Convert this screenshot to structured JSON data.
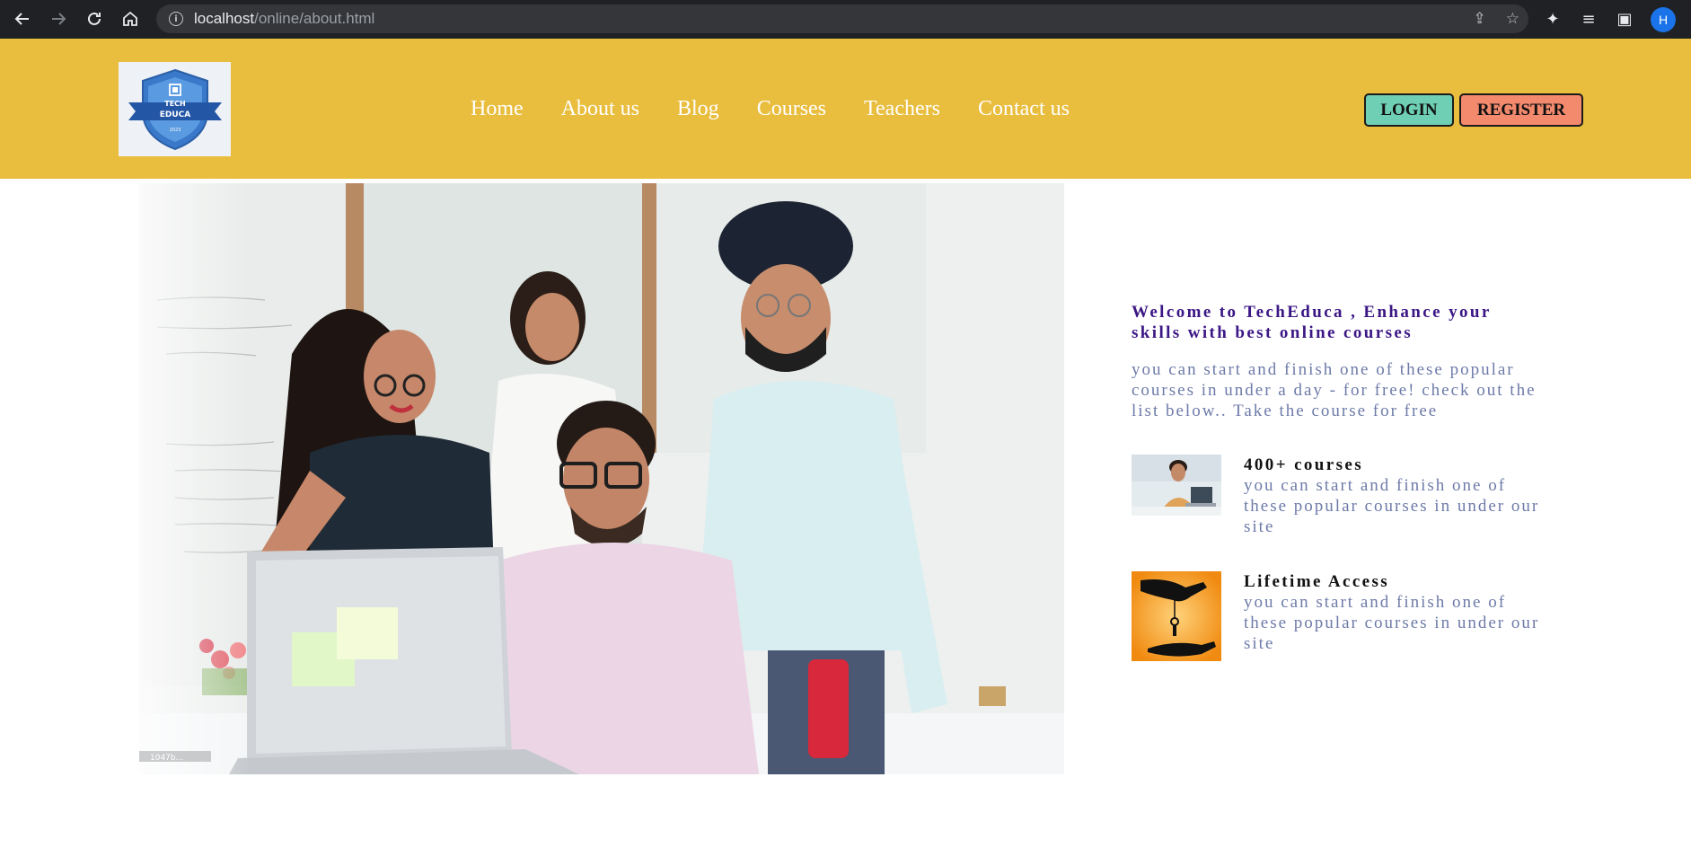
{
  "browser": {
    "url_host": "localhost",
    "url_path": "/online/about.html",
    "profile_initial": "H"
  },
  "header": {
    "logo_text": [
      "TECH",
      "EDUCA",
      "2023"
    ],
    "nav": [
      "Home",
      "About us",
      "Blog",
      "Courses",
      "Teachers",
      "Contact us"
    ],
    "login_label": "LOGIN",
    "register_label": "REGISTER"
  },
  "hero": {
    "watermark": "1047b..."
  },
  "info": {
    "welcome": "Welcome to TechEduca , Enhance your skills with best online courses",
    "intro": "you can start and finish one of these popular courses in under a day - for free! check out the list below.. Take the course for free",
    "features": [
      {
        "title": "400+ courses",
        "desc": "you can start and finish one of these popular courses in under our site"
      },
      {
        "title": "Lifetime Access",
        "desc": "you can start and finish one of these popular courses in under our site"
      }
    ]
  },
  "colors": {
    "header_bg": "#e9bd3d",
    "login_bg": "#6fcfb4",
    "register_bg": "#f3896d",
    "welcome_text": "#3b1685",
    "body_text": "#6d7aa8"
  }
}
